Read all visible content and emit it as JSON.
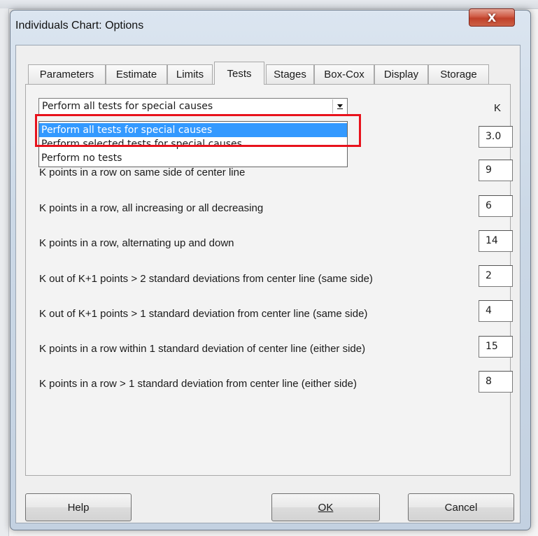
{
  "dialog": {
    "title": "Individuals Chart: Options",
    "close_glyph": "X"
  },
  "tabs": [
    {
      "label": "Parameters",
      "active": false
    },
    {
      "label": "Estimate",
      "active": false
    },
    {
      "label": "Limits",
      "active": false
    },
    {
      "label": "Tests",
      "active": true
    },
    {
      "label": "Stages",
      "active": false
    },
    {
      "label": "Box-Cox",
      "active": false
    },
    {
      "label": "Display",
      "active": false
    },
    {
      "label": "Storage",
      "active": false
    }
  ],
  "tests_mode": {
    "selected": "Perform all tests for special causes",
    "options": [
      "Perform all tests for special causes",
      "Perform selected tests for special causes",
      "Perform no tests"
    ],
    "highlighted_index": 0
  },
  "k_header": "K",
  "tests": [
    {
      "label": "",
      "k": "3.0"
    },
    {
      "label": "K points in a row on same side of center line",
      "k": "9"
    },
    {
      "label": "K points in a row, all increasing or all decreasing",
      "k": "6"
    },
    {
      "label": "K points in a row, alternating up and down",
      "k": "14"
    },
    {
      "label": "K out of K+1 points > 2 standard deviations from center line (same side)",
      "k": "2"
    },
    {
      "label": "K out of K+1 points > 1 standard deviation from center line (same side)",
      "k": "4"
    },
    {
      "label": "K points in a row within 1 standard deviation of center line (either side)",
      "k": "15"
    },
    {
      "label": "K points in a row > 1 standard deviation from center line (either side)",
      "k": "8"
    }
  ],
  "buttons": {
    "help": "Help",
    "ok": "OK",
    "cancel": "Cancel"
  },
  "colors": {
    "selection": "#3399ff",
    "highlight_box": "#e8121c",
    "close_button": "#c8442e"
  }
}
